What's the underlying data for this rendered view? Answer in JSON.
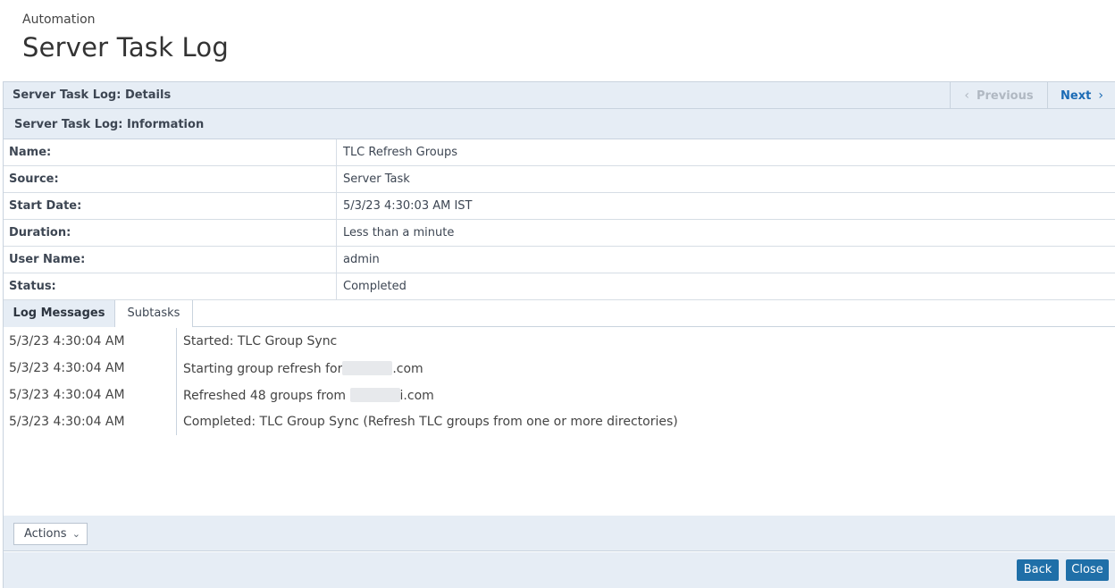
{
  "header": {
    "breadcrumb": "Automation",
    "title": "Server Task Log"
  },
  "details": {
    "title": "Server Task Log: Details",
    "previous_label": "Previous",
    "next_label": "Next"
  },
  "information": {
    "title": "Server Task Log: Information",
    "rows": [
      {
        "label": "Name:",
        "value": "TLC Refresh Groups"
      },
      {
        "label": "Source:",
        "value": "Server Task"
      },
      {
        "label": "Start Date:",
        "value": "5/3/23 4:30:03 AM IST"
      },
      {
        "label": "Duration:",
        "value": "Less than a minute"
      },
      {
        "label": "User Name:",
        "value": "admin"
      },
      {
        "label": "Status:",
        "value": "Completed"
      }
    ]
  },
  "tabs": [
    {
      "label": "Log Messages",
      "active": true
    },
    {
      "label": "Subtasks",
      "active": false
    }
  ],
  "log_messages": [
    {
      "time": "5/3/23 4:30:04 AM",
      "message": "Started: TLC Group Sync"
    },
    {
      "time": "5/3/23 4:30:04 AM",
      "message_prefix": "Starting group refresh for",
      "message_suffix": ".com"
    },
    {
      "time": "5/3/23 4:30:04 AM",
      "message_prefix": "Refreshed 48 groups from",
      "message_suffix": "i.com"
    },
    {
      "time": "5/3/23 4:30:04 AM",
      "message": "Completed: TLC Group Sync (Refresh TLC groups from one or more directories)"
    }
  ],
  "actions": {
    "label": "Actions"
  },
  "footer": {
    "back_label": "Back",
    "close_label": "Close"
  },
  "icons": {
    "previous": "chevron-left-icon",
    "next": "chevron-right-icon",
    "actions": "chevron-down-icon"
  },
  "colors": {
    "primary_button": "#1f6fa8",
    "link": "#1b6bb5",
    "bar_background": "#e6edf5"
  }
}
